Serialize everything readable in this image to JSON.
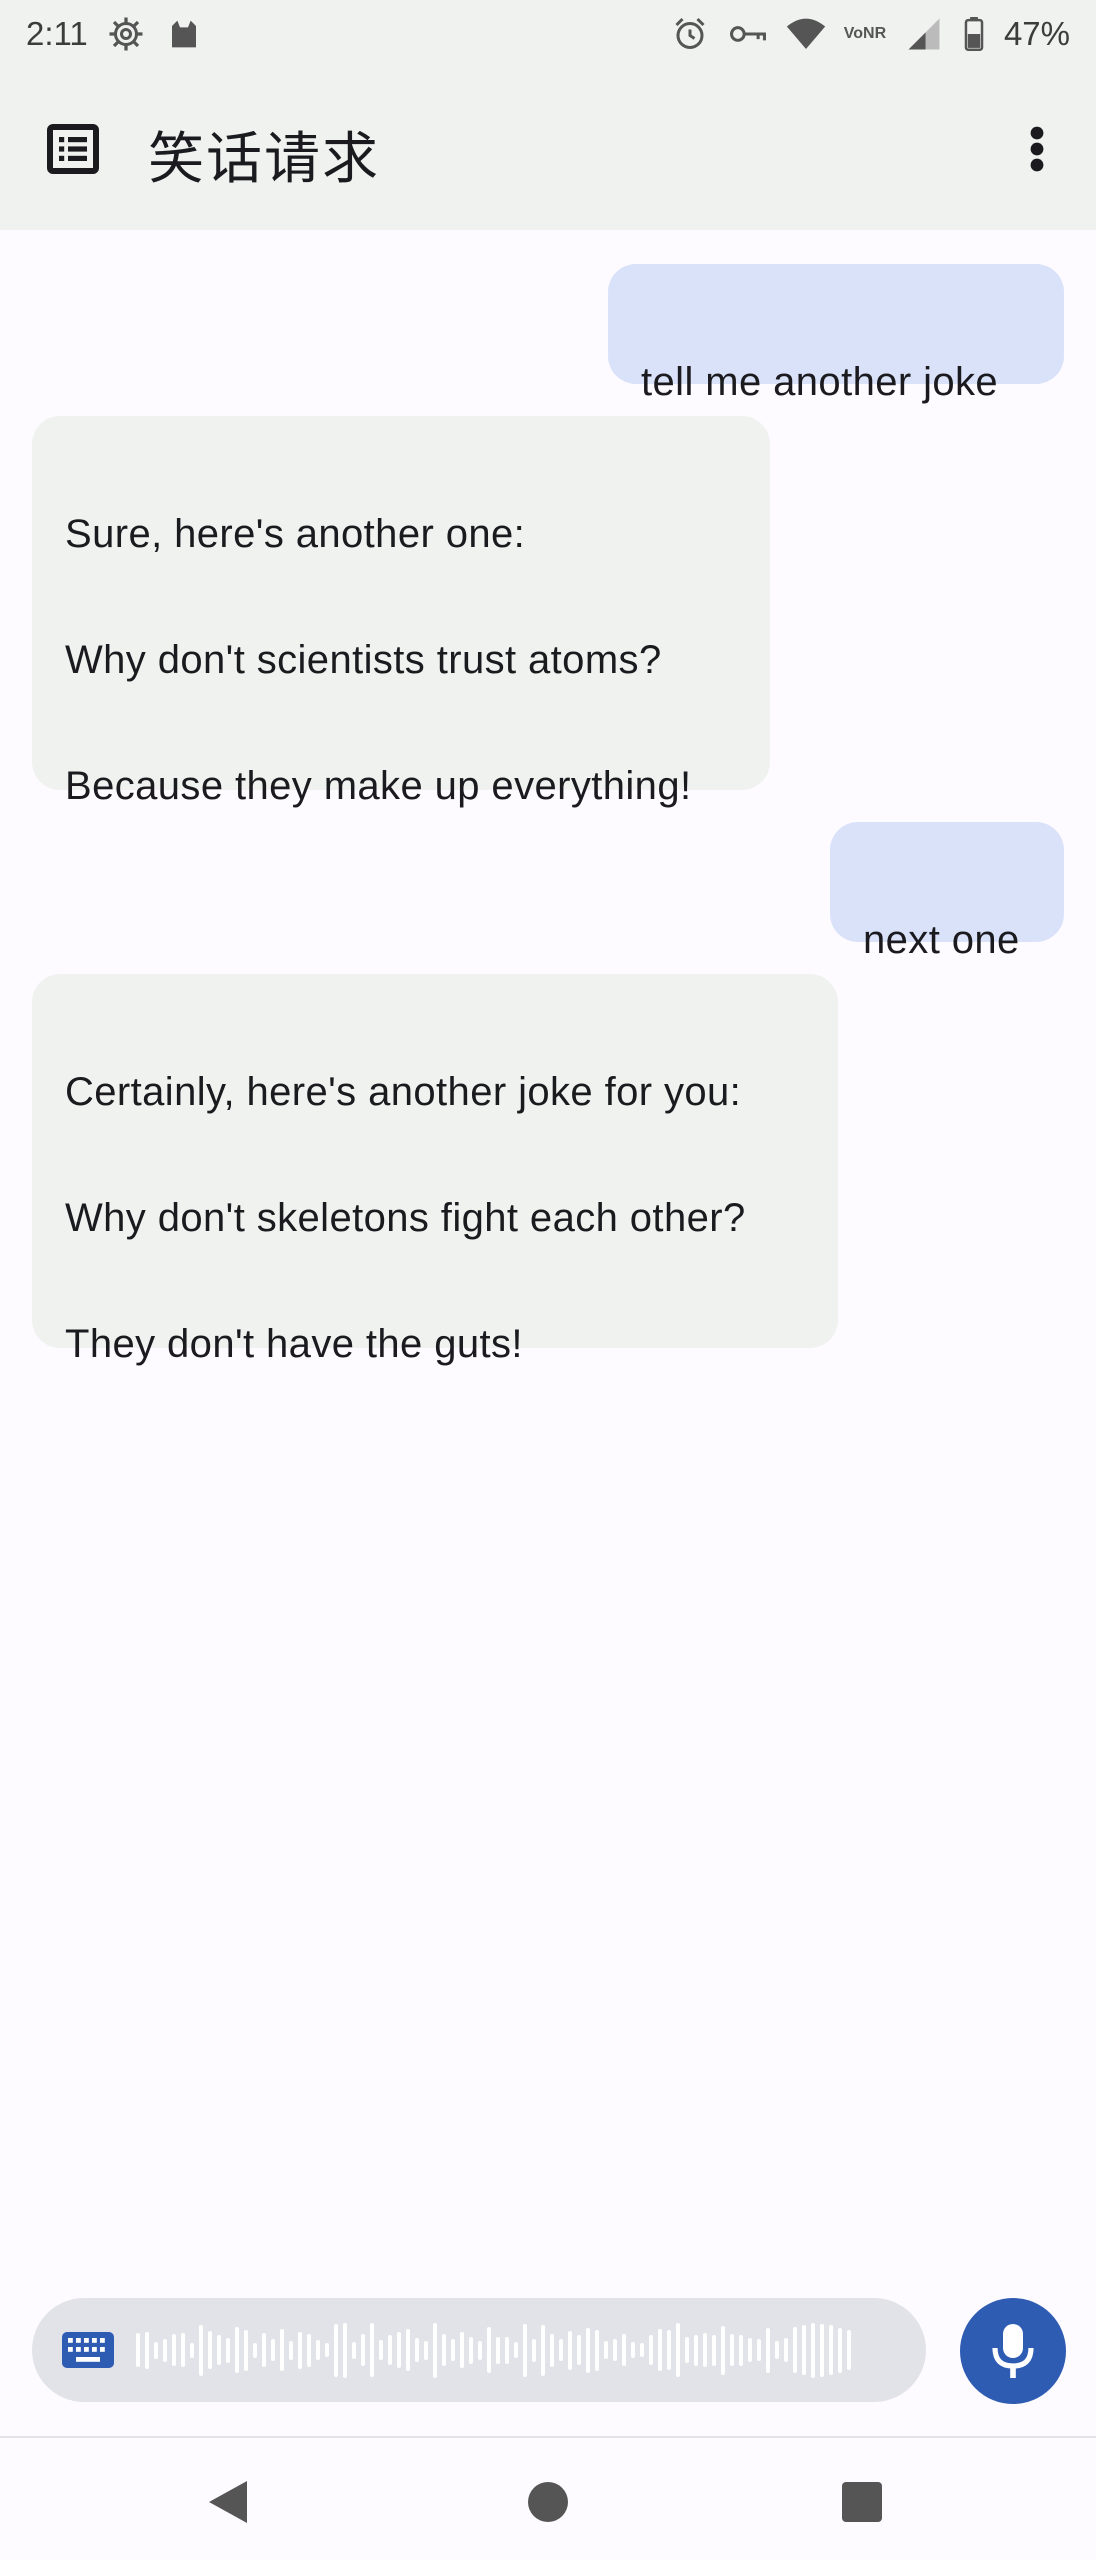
{
  "status_bar": {
    "time": "2:11",
    "battery": "47%",
    "network": "VoNR",
    "left_icons": [
      "settings-gear-icon",
      "cat-icon"
    ],
    "right_icons": [
      "alarm-icon",
      "vpn-key-icon",
      "wifi-icon",
      "vonr-icon",
      "signal-icon",
      "battery-icon"
    ]
  },
  "app_bar": {
    "title": "笑话请求",
    "menu_icon": "list-icon",
    "overflow_icon": "more-vert-icon",
    "background": "#f0f2f0"
  },
  "messages": [
    {
      "role": "user",
      "text": "tell me another joke"
    },
    {
      "role": "assistant",
      "text": "Sure, here's another one:\n\nWhy don't scientists trust atoms?\n\nBecause they make up everything!"
    },
    {
      "role": "user",
      "text": "next one"
    },
    {
      "role": "assistant",
      "text": "Certainly, here's another joke for you:\n\nWhy don't skeletons fight each other?\n\nThey don't have the guts!"
    }
  ],
  "input": {
    "keyboard_icon": "keyboard-icon",
    "mic_icon": "mic-icon",
    "state": "listening"
  },
  "nav_bar": {
    "back_icon": "back-triangle-icon",
    "home_icon": "home-circle-icon",
    "recents_icon": "recents-square-icon"
  },
  "colors": {
    "user_bubble": "#dae2fa",
    "assistant_bubble": "#f0f2f0",
    "accent": "#2f5cb3",
    "background": "#fdfbff"
  }
}
